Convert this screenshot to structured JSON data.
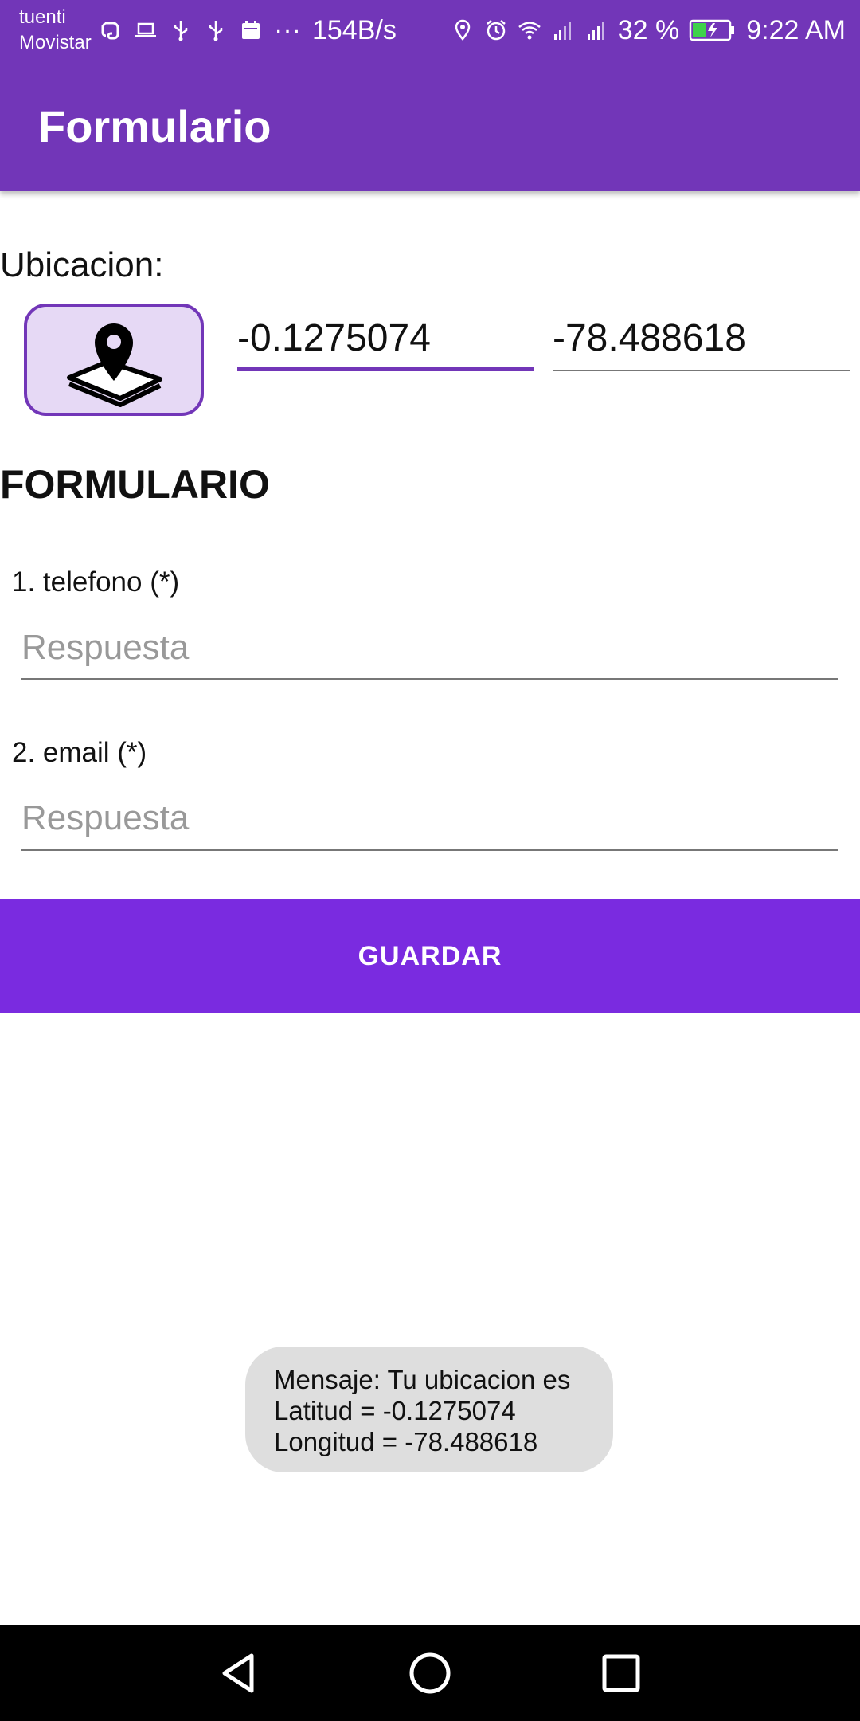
{
  "status_bar": {
    "carrier_line1": "tuenti",
    "carrier_line2": "Movistar",
    "icons": [
      "evernote-icon",
      "laptop-icon",
      "usb-icon",
      "usb-icon",
      "calendar-icon",
      "more-icon"
    ],
    "speed": "154B/s",
    "right_icons": [
      "location-icon",
      "alarm-icon",
      "wifi-icon",
      "signal-icon",
      "signal-icon"
    ],
    "battery": "32 %",
    "time": "9:22 AM"
  },
  "app_bar": {
    "title": "Formulario"
  },
  "location": {
    "label": "Ubicacion:",
    "button_icon": "map-pin-phone-icon",
    "latitude": "-0.1275074",
    "longitude": "-78.488618"
  },
  "form": {
    "heading": "FORMULARIO",
    "questions": [
      {
        "label": "1. telefono (*)",
        "placeholder": "Respuesta"
      },
      {
        "label": "2. email (*)",
        "placeholder": "Respuesta"
      }
    ],
    "save_label": "GUARDAR"
  },
  "toast": {
    "line1": "Mensaje: Tu ubicacion es",
    "line2": "Latitud = -0.1275074",
    "line3": "Longitud = -78.488618"
  },
  "nav": {
    "icons": [
      "back-icon",
      "home-icon",
      "recents-icon"
    ]
  },
  "colors": {
    "primary": "#7236b8",
    "button": "#7a2be0",
    "location_button_bg": "#e6d9f5",
    "toast_bg": "#dedede"
  }
}
